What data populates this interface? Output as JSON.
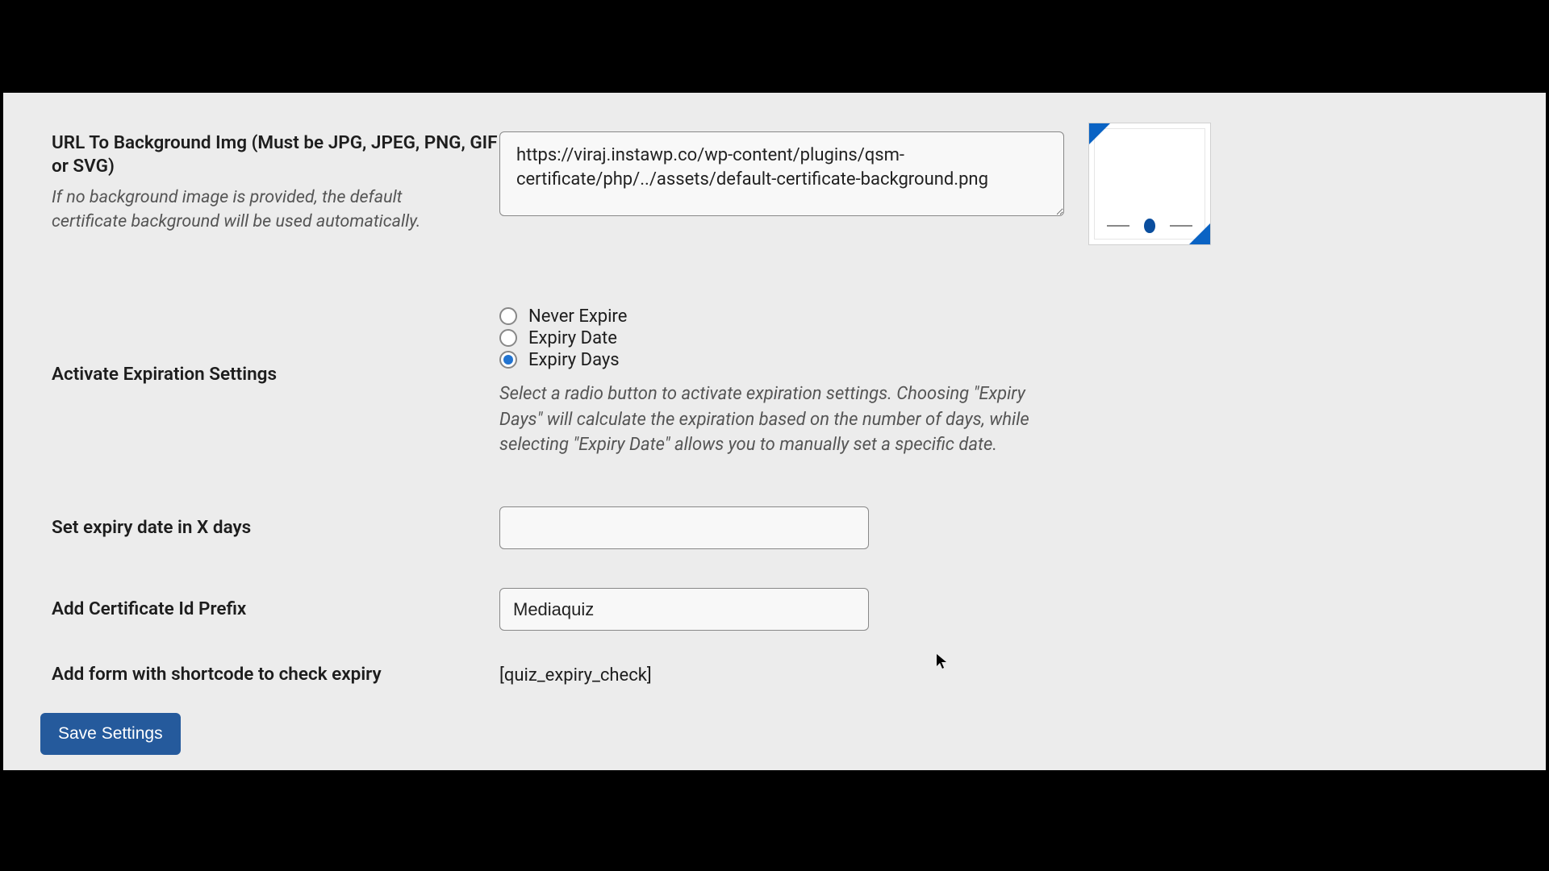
{
  "bgimg": {
    "label": "URL To Background Img (Must be JPG, JPEG, PNG, GIF or SVG)",
    "desc": "If no background image is provided, the default certificate background will be used automatically.",
    "value": "https://viraj.instawp.co/wp-content/plugins/qsm-certificate/php/../assets/default-certificate-background.png"
  },
  "expiration": {
    "label": "Activate Expiration Settings",
    "options": {
      "never": "Never Expire",
      "date": "Expiry Date",
      "days": "Expiry Days"
    },
    "selected": "days",
    "help": "Select a radio button to activate expiration settings. Choosing \"Expiry Days\" will calculate the expiration based on the number of days, while selecting \"Expiry Date\" allows you to manually set a specific date."
  },
  "expiry_days": {
    "label": "Set expiry date in X days",
    "value": ""
  },
  "cert_prefix": {
    "label": "Add Certificate Id Prefix",
    "value": "Mediaquiz"
  },
  "shortcode": {
    "label": "Add form with shortcode to check expiry",
    "value": "[quiz_expiry_check]"
  },
  "save_label": "Save Settings"
}
